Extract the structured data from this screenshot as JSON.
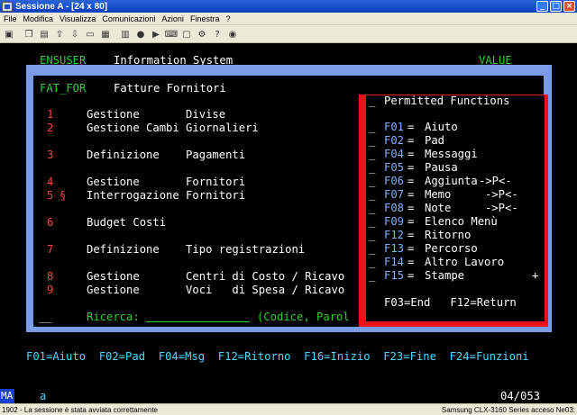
{
  "window": {
    "title": "Sessione A - [24 x 80]"
  },
  "menubar": {
    "items": [
      "File",
      "Modifica",
      "Visualizza",
      "Comunicazioni",
      "Azioni",
      "Finestra",
      "?"
    ]
  },
  "toolbar": {
    "icons": [
      "print-icon",
      "copy-icon",
      "paste-icon",
      "send-icon",
      "receive-icon",
      "display-icon",
      "color-icon",
      "macro-icon",
      "record-icon",
      "play-icon",
      "keyboard-icon",
      "clipboard-icon",
      "settings-icon",
      "help-icon",
      "support-icon"
    ]
  },
  "terminal": {
    "header_left": "ENSUSER",
    "header_title": "Information System",
    "header_right": "VALUE",
    "panel_code": "FAT_FOR",
    "panel_title": "Fatture Fornitori",
    "menu_rows": [
      {
        "num": "1",
        "marker": "",
        "text": "Gestione       Divise"
      },
      {
        "num": "2",
        "marker": "",
        "text": "Gestione Cambi Giornalieri"
      },
      {
        "num": "3",
        "marker": "",
        "text": "Definizione    Pagamenti"
      },
      {
        "num": "4",
        "marker": "",
        "text": "Gestione       Fornitori"
      },
      {
        "num": "5",
        "marker": "§",
        "text": "Interrogazione Fornitori"
      },
      {
        "num": "6",
        "marker": "",
        "text": "Budget Costi"
      },
      {
        "num": "7",
        "marker": "",
        "text": "Definizione    Tipo registrazioni"
      },
      {
        "num": "8",
        "marker": "",
        "text": "Gestione       Centri di Costo / Ricavo"
      },
      {
        "num": "9",
        "marker": "",
        "text": "Gestione       Voci   di Spesa / Ricavo"
      }
    ],
    "option_input": "__",
    "ricerca_label": "Ricerca:",
    "ricerca_value": "",
    "ricerca_hint": "(Codice, Parol",
    "popup": {
      "title": "Permitted Functions",
      "functions": [
        {
          "key": "F01",
          "label": "Aiuto",
          "suffix": ""
        },
        {
          "key": "F02",
          "label": "Pad",
          "suffix": ""
        },
        {
          "key": "F04",
          "label": "Messaggi",
          "suffix": ""
        },
        {
          "key": "F05",
          "label": "Pausa",
          "suffix": ""
        },
        {
          "key": "F06",
          "label": "Aggiunta",
          "suffix": "->P<-"
        },
        {
          "key": "F07",
          "label": "Memo",
          "suffix": "->P<-"
        },
        {
          "key": "F08",
          "label": "Note",
          "suffix": "->P<-"
        },
        {
          "key": "F09",
          "label": "Elenco Menù",
          "suffix": ""
        },
        {
          "key": "F12",
          "label": "Ritorno",
          "suffix": ""
        },
        {
          "key": "F13",
          "label": "Percorso",
          "suffix": ""
        },
        {
          "key": "F14",
          "label": "Altro Lavoro",
          "suffix": ""
        },
        {
          "key": "F15",
          "label": "Stampe",
          "suffix": ""
        }
      ],
      "more": "+",
      "footer": "F03=End   F12=Return"
    },
    "fkeys_line": "F01=Aiuto  F02=Pad  F04=Msg  F12=Ritorno  F16=Inizio  F23=Fine  F24=Funzioni"
  },
  "oia": {
    "mode": "MA",
    "cursor_char": "a",
    "position": "04/053"
  },
  "statusbar": {
    "message": "1902 - La sessione è stata avviata correttamente",
    "printer": "Samsung CLX-3160 Series acceso Ne03:"
  }
}
